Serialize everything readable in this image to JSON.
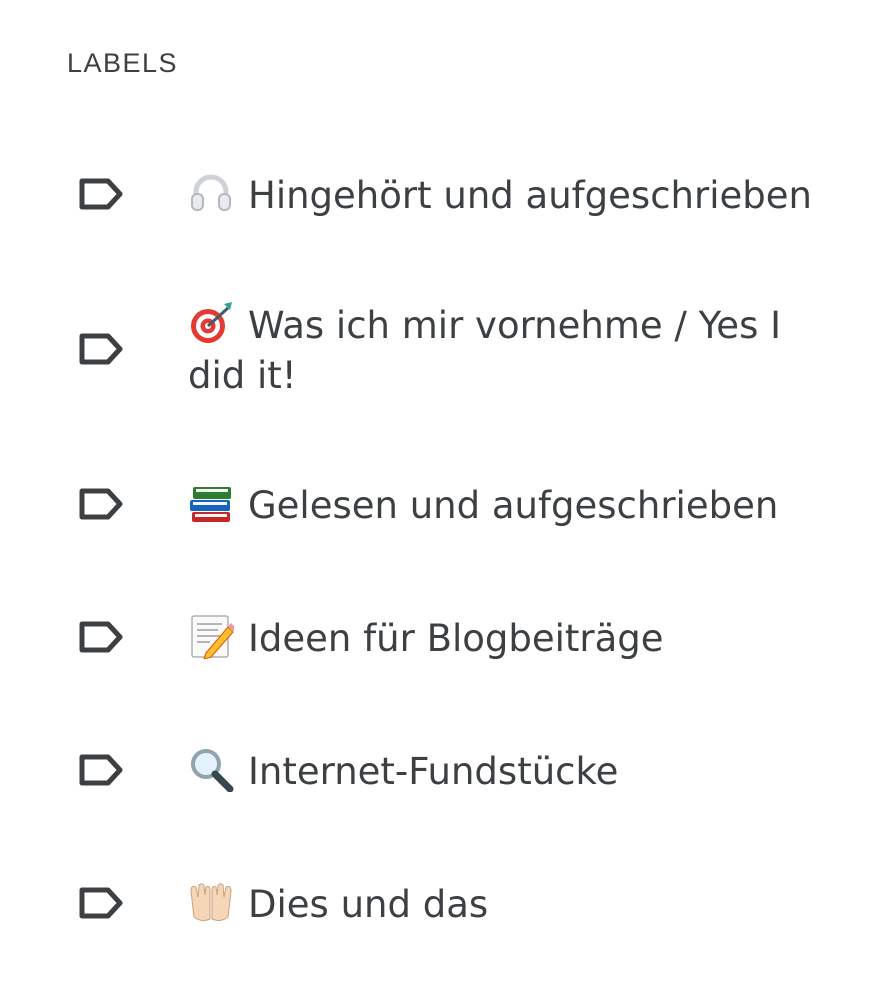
{
  "section": {
    "title": "LABELS"
  },
  "labels": [
    {
      "emoji": "headphones",
      "text": "Hingehört und aufgeschrieben"
    },
    {
      "emoji": "direct-hit",
      "text": "Was ich mir vornehme / Yes I did it!"
    },
    {
      "emoji": "books",
      "text": "Gelesen und aufgeschrieben"
    },
    {
      "emoji": "memo",
      "text": "Ideen für Blogbeiträge"
    },
    {
      "emoji": "magnifying-glass",
      "text": "Internet-Fundstücke"
    },
    {
      "emoji": "palms-up-together",
      "text": "Dies und das"
    }
  ],
  "colors": {
    "text": "#3c4043",
    "icon_stroke": "#3c4043",
    "background": "#ffffff"
  }
}
